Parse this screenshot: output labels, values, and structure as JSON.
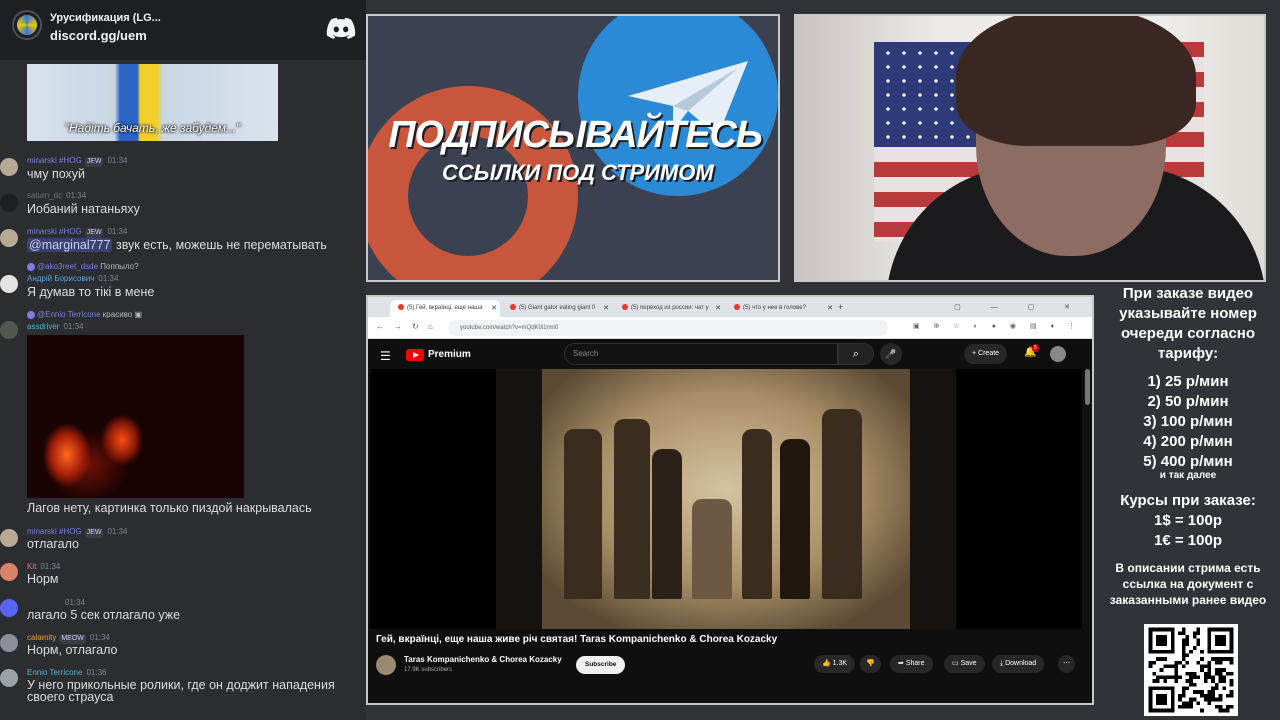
{
  "discord": {
    "server_name": "Урусификация (LG...",
    "invite_link": "discord.gg/uem",
    "flag_caption": "\"Надіть бачать, же забудем...\"",
    "messages": [
      {
        "user": "minarski #HOG",
        "badge": "JEW",
        "time": "01:34",
        "text": "чму похуй",
        "user_color": "#7b7ee0"
      },
      {
        "user": "saturn_dc",
        "time": "01:34",
        "text": "Иобаний натаньяху",
        "user_color": "#6d7178"
      },
      {
        "user": "minarski #HOG",
        "badge": "JEW",
        "time": "01:34",
        "mention": "@marginal777",
        "text": " звук есть, можешь не перематывать",
        "user_color": "#7b7ee0"
      },
      {
        "reply": "Поппыло?",
        "reply_user": "@ako3reet_dsde",
        "user": "Андрій Борисович",
        "time": "01:34",
        "text": "Я думав то тікі в мене",
        "user_color": "#5aa7e0"
      },
      {
        "reply": "красиво",
        "reply_user": "@Ennio Terricone",
        "user": "assdriver",
        "time": "01:34",
        "text": "",
        "user_color": "#4fb7c9"
      },
      {
        "user": "",
        "time": "",
        "text": "Лагов нету, картинка только пиздой накрывалась",
        "user_color": "#dbdee1"
      },
      {
        "user": "minarski #HOG",
        "badge": "JEW",
        "time": "01:34",
        "text": "отлагало",
        "user_color": "#7b7ee0"
      },
      {
        "user": "Kit",
        "time": "01:34",
        "text": "Норм",
        "user_color": "#e07b7b"
      },
      {
        "user": "",
        "time": "01:34",
        "text": "лагало 5 сек отлагало уже",
        "user_color": "#6d7178"
      },
      {
        "user": "calamity",
        "badge": "MEOW",
        "time": "01:34",
        "text": "Норм, отлагало",
        "user_color": "#e0a03a"
      },
      {
        "user": "Ennio Terricone",
        "time": "01:36",
        "text": "У него прикольные ролики, где он доджит нападения своего страуса",
        "user_color": "#4fb7c9"
      }
    ]
  },
  "promo": {
    "title": "ПОДПИСЫВАЙТЕСЬ",
    "subtitle": "ССЫЛКИ ПОД СТРИМОМ"
  },
  "browser": {
    "tabs": [
      "(5) Гей, вкраїнці, еще наша",
      "(5) Giant gator eating giant fi",
      "(5) переход из россии: чат у",
      "(5) что у нее в голове?"
    ],
    "url": "youtube.com/watch?v=mQdK0i1rmi0",
    "yt_brand": "Premium",
    "search_placeholder": "Search",
    "create_label": "Create",
    "notifications": "5",
    "video_title": "Гей, вкраїнці, еще наша живе річ святая! Taras Kompanichenko & Chorea Kozacky",
    "channel_name": "Taras Kompanichenko & Chorea Kozacky",
    "channel_subs": "17.9K subscribers",
    "subscribe_label": "Subscribe",
    "likes": "1.3K",
    "share_label": "Share",
    "save_label": "Save",
    "download_label": "Download"
  },
  "info": {
    "order_head": "При заказе видео указывайте номер очереди согласно тарифу:",
    "tariffs": [
      "1) 25 р/мин",
      "2) 50 р/мин",
      "3) 100 р/мин",
      "4) 200 р/мин",
      "5) 400 р/мин"
    ],
    "etc": "и так далее",
    "rates_head": "Курсы при заказе:",
    "rates": [
      "1$ = 100р",
      "1€ = 100р"
    ],
    "desc": "В описании стрима есть ссылка на документ с заказанными ранее видео"
  },
  "colors": {
    "discord_bg": "#2b2d31",
    "youtube_red": "#ff0000",
    "accent_blue": "#2b8ad6",
    "accent_orange": "#e05a3a"
  }
}
